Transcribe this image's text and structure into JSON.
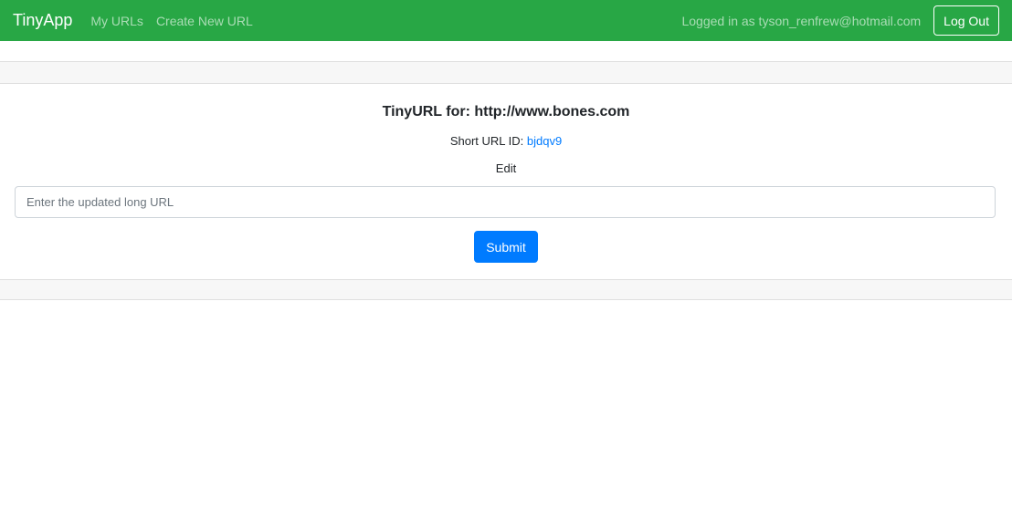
{
  "navbar": {
    "brand": "TinyApp",
    "links": [
      "My URLs",
      "Create New URL"
    ],
    "logged_in_text": "Logged in as tyson_renfrew@hotmail.com",
    "logout_label": "Log Out",
    "bg_color": "#28a745"
  },
  "card": {
    "title": "TinyURL for: http://www.bones.com",
    "short_url_label": "Short URL ID: ",
    "short_url_id": "bjdqv9",
    "edit_label": "Edit",
    "input_placeholder": "Enter the updated long URL",
    "input_value": "",
    "submit_label": "Submit",
    "link_color": "#007bff"
  }
}
